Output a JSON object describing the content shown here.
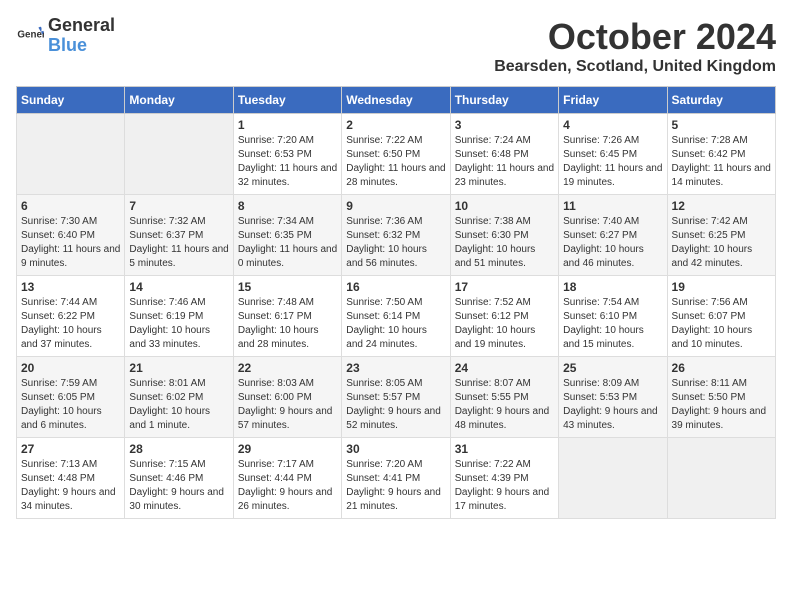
{
  "logo": {
    "text_general": "General",
    "text_blue": "Blue"
  },
  "title": "October 2024",
  "location": "Bearsden, Scotland, United Kingdom",
  "headers": [
    "Sunday",
    "Monday",
    "Tuesday",
    "Wednesday",
    "Thursday",
    "Friday",
    "Saturday"
  ],
  "weeks": [
    [
      {
        "day": "",
        "sunrise": "",
        "sunset": "",
        "daylight": ""
      },
      {
        "day": "",
        "sunrise": "",
        "sunset": "",
        "daylight": ""
      },
      {
        "day": "1",
        "sunrise": "Sunrise: 7:20 AM",
        "sunset": "Sunset: 6:53 PM",
        "daylight": "Daylight: 11 hours and 32 minutes."
      },
      {
        "day": "2",
        "sunrise": "Sunrise: 7:22 AM",
        "sunset": "Sunset: 6:50 PM",
        "daylight": "Daylight: 11 hours and 28 minutes."
      },
      {
        "day": "3",
        "sunrise": "Sunrise: 7:24 AM",
        "sunset": "Sunset: 6:48 PM",
        "daylight": "Daylight: 11 hours and 23 minutes."
      },
      {
        "day": "4",
        "sunrise": "Sunrise: 7:26 AM",
        "sunset": "Sunset: 6:45 PM",
        "daylight": "Daylight: 11 hours and 19 minutes."
      },
      {
        "day": "5",
        "sunrise": "Sunrise: 7:28 AM",
        "sunset": "Sunset: 6:42 PM",
        "daylight": "Daylight: 11 hours and 14 minutes."
      }
    ],
    [
      {
        "day": "6",
        "sunrise": "Sunrise: 7:30 AM",
        "sunset": "Sunset: 6:40 PM",
        "daylight": "Daylight: 11 hours and 9 minutes."
      },
      {
        "day": "7",
        "sunrise": "Sunrise: 7:32 AM",
        "sunset": "Sunset: 6:37 PM",
        "daylight": "Daylight: 11 hours and 5 minutes."
      },
      {
        "day": "8",
        "sunrise": "Sunrise: 7:34 AM",
        "sunset": "Sunset: 6:35 PM",
        "daylight": "Daylight: 11 hours and 0 minutes."
      },
      {
        "day": "9",
        "sunrise": "Sunrise: 7:36 AM",
        "sunset": "Sunset: 6:32 PM",
        "daylight": "Daylight: 10 hours and 56 minutes."
      },
      {
        "day": "10",
        "sunrise": "Sunrise: 7:38 AM",
        "sunset": "Sunset: 6:30 PM",
        "daylight": "Daylight: 10 hours and 51 minutes."
      },
      {
        "day": "11",
        "sunrise": "Sunrise: 7:40 AM",
        "sunset": "Sunset: 6:27 PM",
        "daylight": "Daylight: 10 hours and 46 minutes."
      },
      {
        "day": "12",
        "sunrise": "Sunrise: 7:42 AM",
        "sunset": "Sunset: 6:25 PM",
        "daylight": "Daylight: 10 hours and 42 minutes."
      }
    ],
    [
      {
        "day": "13",
        "sunrise": "Sunrise: 7:44 AM",
        "sunset": "Sunset: 6:22 PM",
        "daylight": "Daylight: 10 hours and 37 minutes."
      },
      {
        "day": "14",
        "sunrise": "Sunrise: 7:46 AM",
        "sunset": "Sunset: 6:19 PM",
        "daylight": "Daylight: 10 hours and 33 minutes."
      },
      {
        "day": "15",
        "sunrise": "Sunrise: 7:48 AM",
        "sunset": "Sunset: 6:17 PM",
        "daylight": "Daylight: 10 hours and 28 minutes."
      },
      {
        "day": "16",
        "sunrise": "Sunrise: 7:50 AM",
        "sunset": "Sunset: 6:14 PM",
        "daylight": "Daylight: 10 hours and 24 minutes."
      },
      {
        "day": "17",
        "sunrise": "Sunrise: 7:52 AM",
        "sunset": "Sunset: 6:12 PM",
        "daylight": "Daylight: 10 hours and 19 minutes."
      },
      {
        "day": "18",
        "sunrise": "Sunrise: 7:54 AM",
        "sunset": "Sunset: 6:10 PM",
        "daylight": "Daylight: 10 hours and 15 minutes."
      },
      {
        "day": "19",
        "sunrise": "Sunrise: 7:56 AM",
        "sunset": "Sunset: 6:07 PM",
        "daylight": "Daylight: 10 hours and 10 minutes."
      }
    ],
    [
      {
        "day": "20",
        "sunrise": "Sunrise: 7:59 AM",
        "sunset": "Sunset: 6:05 PM",
        "daylight": "Daylight: 10 hours and 6 minutes."
      },
      {
        "day": "21",
        "sunrise": "Sunrise: 8:01 AM",
        "sunset": "Sunset: 6:02 PM",
        "daylight": "Daylight: 10 hours and 1 minute."
      },
      {
        "day": "22",
        "sunrise": "Sunrise: 8:03 AM",
        "sunset": "Sunset: 6:00 PM",
        "daylight": "Daylight: 9 hours and 57 minutes."
      },
      {
        "day": "23",
        "sunrise": "Sunrise: 8:05 AM",
        "sunset": "Sunset: 5:57 PM",
        "daylight": "Daylight: 9 hours and 52 minutes."
      },
      {
        "day": "24",
        "sunrise": "Sunrise: 8:07 AM",
        "sunset": "Sunset: 5:55 PM",
        "daylight": "Daylight: 9 hours and 48 minutes."
      },
      {
        "day": "25",
        "sunrise": "Sunrise: 8:09 AM",
        "sunset": "Sunset: 5:53 PM",
        "daylight": "Daylight: 9 hours and 43 minutes."
      },
      {
        "day": "26",
        "sunrise": "Sunrise: 8:11 AM",
        "sunset": "Sunset: 5:50 PM",
        "daylight": "Daylight: 9 hours and 39 minutes."
      }
    ],
    [
      {
        "day": "27",
        "sunrise": "Sunrise: 7:13 AM",
        "sunset": "Sunset: 4:48 PM",
        "daylight": "Daylight: 9 hours and 34 minutes."
      },
      {
        "day": "28",
        "sunrise": "Sunrise: 7:15 AM",
        "sunset": "Sunset: 4:46 PM",
        "daylight": "Daylight: 9 hours and 30 minutes."
      },
      {
        "day": "29",
        "sunrise": "Sunrise: 7:17 AM",
        "sunset": "Sunset: 4:44 PM",
        "daylight": "Daylight: 9 hours and 26 minutes."
      },
      {
        "day": "30",
        "sunrise": "Sunrise: 7:20 AM",
        "sunset": "Sunset: 4:41 PM",
        "daylight": "Daylight: 9 hours and 21 minutes."
      },
      {
        "day": "31",
        "sunrise": "Sunrise: 7:22 AM",
        "sunset": "Sunset: 4:39 PM",
        "daylight": "Daylight: 9 hours and 17 minutes."
      },
      {
        "day": "",
        "sunrise": "",
        "sunset": "",
        "daylight": ""
      },
      {
        "day": "",
        "sunrise": "",
        "sunset": "",
        "daylight": ""
      }
    ]
  ]
}
